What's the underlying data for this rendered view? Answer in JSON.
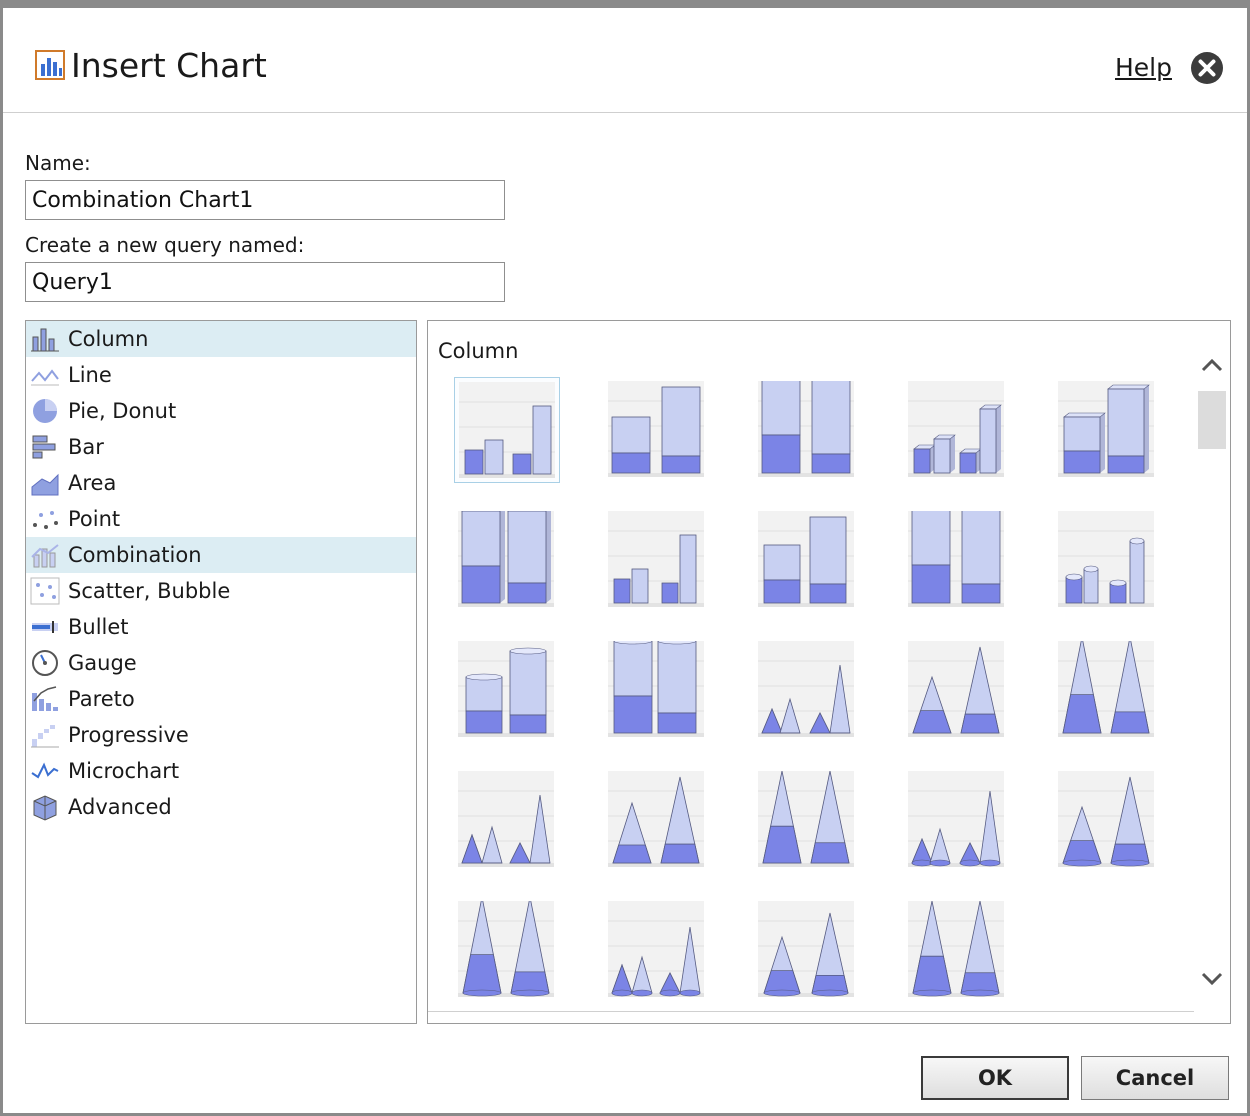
{
  "dialog": {
    "title": "Insert Chart",
    "help_label": "Help"
  },
  "form": {
    "name_label": "Name:",
    "name_value": "Combination Chart1",
    "query_label": "Create a new query named:",
    "query_value": "Query1"
  },
  "chart_types": [
    {
      "label": "Column",
      "icon": "column-chart-icon",
      "selected": true
    },
    {
      "label": "Line",
      "icon": "line-chart-icon"
    },
    {
      "label": "Pie, Donut",
      "icon": "pie-chart-icon"
    },
    {
      "label": "Bar",
      "icon": "bar-chart-icon"
    },
    {
      "label": "Area",
      "icon": "area-chart-icon"
    },
    {
      "label": "Point",
      "icon": "point-chart-icon"
    },
    {
      "label": "Combination",
      "icon": "combination-chart-icon",
      "highlighted": true
    },
    {
      "label": "Scatter, Bubble",
      "icon": "scatter-chart-icon"
    },
    {
      "label": "Bullet",
      "icon": "bullet-chart-icon"
    },
    {
      "label": "Gauge",
      "icon": "gauge-icon"
    },
    {
      "label": "Pareto",
      "icon": "pareto-chart-icon"
    },
    {
      "label": "Progressive",
      "icon": "progressive-chart-icon"
    },
    {
      "label": "Microchart",
      "icon": "microchart-icon"
    },
    {
      "label": "Advanced",
      "icon": "advanced-chart-icon"
    }
  ],
  "gallery": {
    "title": "Column",
    "thumbnails": [
      "clustered-column-thumbnail",
      "stacked-column-thumbnail",
      "100-percent-stacked-column-thumbnail",
      "3d-clustered-column-thumbnail",
      "3d-stacked-column-thumbnail",
      "3d-100-percent-stacked-column-thumbnail",
      "3d-column-thumbnail",
      "3d-stacked-column-alt-thumbnail",
      "3d-100-percent-column-alt-thumbnail",
      "3d-clustered-column-alt-thumbnail",
      "cylinder-column-thumbnail",
      "cylinder-100-percent-thumbnail",
      "clustered-pyramid-thumbnail",
      "stacked-pyramid-thumbnail",
      "100-percent-pyramid-thumbnail",
      "3d-clustered-pyramid-thumbnail",
      "3d-stacked-pyramid-thumbnail",
      "3d-100-percent-pyramid-thumbnail",
      "clustered-cone-thumbnail",
      "stacked-cone-thumbnail",
      "100-percent-cone-thumbnail",
      "3d-clustered-cone-thumbnail",
      "3d-stacked-cone-thumbnail",
      "3d-100-percent-cone-thumbnail"
    ],
    "selected_index": 0
  },
  "buttons": {
    "ok_label": "OK",
    "cancel_label": "Cancel"
  },
  "colors": {
    "accent_light": "#c8d0f2",
    "accent_dark": "#7b84e6",
    "selection": "#dcedf3"
  }
}
